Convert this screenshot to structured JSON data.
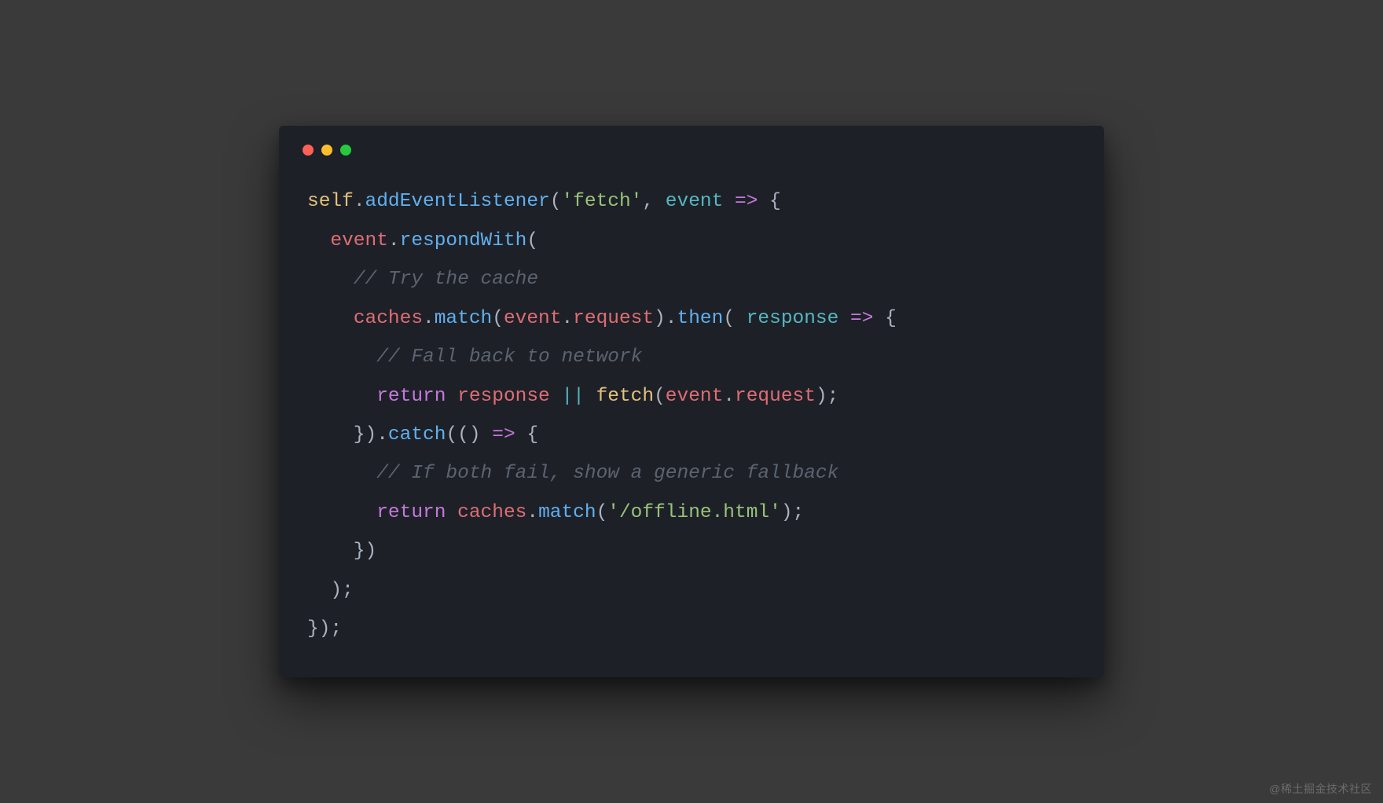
{
  "watermark": "@稀土掘金技术社区",
  "code": {
    "lines": [
      [
        {
          "cls": "tok-self",
          "t": "self"
        },
        {
          "cls": "tok-punct",
          "t": "."
        },
        {
          "cls": "tok-prop",
          "t": "addEventListener"
        },
        {
          "cls": "tok-punct",
          "t": "("
        },
        {
          "cls": "tok-string",
          "t": "'fetch'"
        },
        {
          "cls": "tok-punct",
          "t": ", "
        },
        {
          "cls": "tok-param",
          "t": "event"
        },
        {
          "cls": "tok-punct",
          "t": " "
        },
        {
          "cls": "tok-arrow",
          "t": "=>"
        },
        {
          "cls": "tok-punct",
          "t": " {"
        }
      ],
      [
        {
          "cls": "tok-punct",
          "t": "  "
        },
        {
          "cls": "tok-ident",
          "t": "event"
        },
        {
          "cls": "tok-punct",
          "t": "."
        },
        {
          "cls": "tok-prop",
          "t": "respondWith"
        },
        {
          "cls": "tok-punct",
          "t": "("
        }
      ],
      [
        {
          "cls": "tok-punct",
          "t": "    "
        },
        {
          "cls": "tok-comment",
          "t": "// Try the cache"
        }
      ],
      [
        {
          "cls": "tok-punct",
          "t": "    "
        },
        {
          "cls": "tok-ident",
          "t": "caches"
        },
        {
          "cls": "tok-punct",
          "t": "."
        },
        {
          "cls": "tok-prop",
          "t": "match"
        },
        {
          "cls": "tok-punct",
          "t": "("
        },
        {
          "cls": "tok-ident",
          "t": "event"
        },
        {
          "cls": "tok-punct",
          "t": "."
        },
        {
          "cls": "tok-ident",
          "t": "request"
        },
        {
          "cls": "tok-punct",
          "t": ")."
        },
        {
          "cls": "tok-prop",
          "t": "then"
        },
        {
          "cls": "tok-punct",
          "t": "( "
        },
        {
          "cls": "tok-param",
          "t": "response"
        },
        {
          "cls": "tok-punct",
          "t": " "
        },
        {
          "cls": "tok-arrow",
          "t": "=>"
        },
        {
          "cls": "tok-punct",
          "t": " {"
        }
      ],
      [
        {
          "cls": "tok-punct",
          "t": "      "
        },
        {
          "cls": "tok-comment",
          "t": "// Fall back to network"
        }
      ],
      [
        {
          "cls": "tok-punct",
          "t": "      "
        },
        {
          "cls": "tok-keyword",
          "t": "return"
        },
        {
          "cls": "tok-punct",
          "t": " "
        },
        {
          "cls": "tok-ident",
          "t": "response"
        },
        {
          "cls": "tok-punct",
          "t": " "
        },
        {
          "cls": "tok-op",
          "t": "||"
        },
        {
          "cls": "tok-punct",
          "t": " "
        },
        {
          "cls": "tok-call",
          "t": "fetch"
        },
        {
          "cls": "tok-punct",
          "t": "("
        },
        {
          "cls": "tok-ident",
          "t": "event"
        },
        {
          "cls": "tok-punct",
          "t": "."
        },
        {
          "cls": "tok-ident",
          "t": "request"
        },
        {
          "cls": "tok-punct",
          "t": ");"
        }
      ],
      [
        {
          "cls": "tok-punct",
          "t": "    })."
        },
        {
          "cls": "tok-prop",
          "t": "catch"
        },
        {
          "cls": "tok-punct",
          "t": "(() "
        },
        {
          "cls": "tok-arrow",
          "t": "=>"
        },
        {
          "cls": "tok-punct",
          "t": " {"
        }
      ],
      [
        {
          "cls": "tok-punct",
          "t": "      "
        },
        {
          "cls": "tok-comment",
          "t": "// If both fail, show a generic fallback"
        }
      ],
      [
        {
          "cls": "tok-punct",
          "t": "      "
        },
        {
          "cls": "tok-keyword",
          "t": "return"
        },
        {
          "cls": "tok-punct",
          "t": " "
        },
        {
          "cls": "tok-ident",
          "t": "caches"
        },
        {
          "cls": "tok-punct",
          "t": "."
        },
        {
          "cls": "tok-prop",
          "t": "match"
        },
        {
          "cls": "tok-punct",
          "t": "("
        },
        {
          "cls": "tok-string",
          "t": "'/offline.html'"
        },
        {
          "cls": "tok-punct",
          "t": ");"
        }
      ],
      [
        {
          "cls": "tok-punct",
          "t": "    })"
        }
      ],
      [
        {
          "cls": "tok-punct",
          "t": "  );"
        }
      ],
      [
        {
          "cls": "tok-punct",
          "t": "});"
        }
      ]
    ]
  }
}
